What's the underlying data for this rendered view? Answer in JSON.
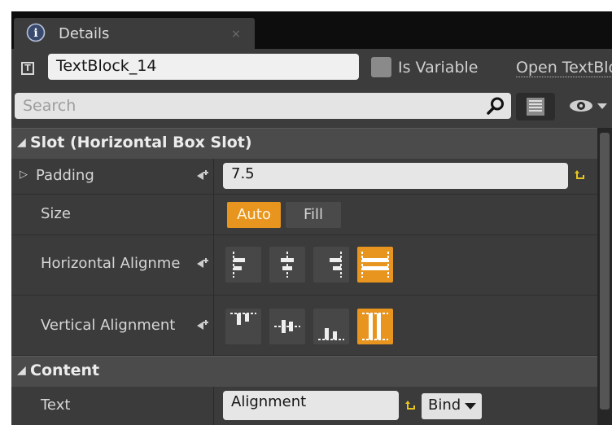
{
  "tab": {
    "title": "Details",
    "close": "×",
    "icon": "info-icon"
  },
  "header": {
    "widget_name": "TextBlock_14",
    "is_variable_label": "Is Variable",
    "open_link": "Open TextBlock"
  },
  "search": {
    "placeholder": "Search"
  },
  "slot": {
    "title": "Slot (Horizontal Box Slot)",
    "padding": {
      "label": "Padding",
      "value": "7.5"
    },
    "size": {
      "label": "Size",
      "options": [
        "Auto",
        "Fill"
      ],
      "selected": "Auto"
    },
    "horizontal_alignment": {
      "label": "Horizontal Alignme",
      "options": [
        "left",
        "center",
        "right",
        "fill"
      ],
      "selected": "fill"
    },
    "vertical_alignment": {
      "label": "Vertical Alignment",
      "options": [
        "top",
        "center",
        "bottom",
        "fill"
      ],
      "selected": "fill"
    }
  },
  "content": {
    "title": "Content",
    "text": {
      "label": "Text",
      "value": "Alignment",
      "bind_label": "Bind"
    }
  },
  "colors": {
    "accent": "#e7951f",
    "panel": "#3b3b3b",
    "header": "#4b4b4b"
  }
}
